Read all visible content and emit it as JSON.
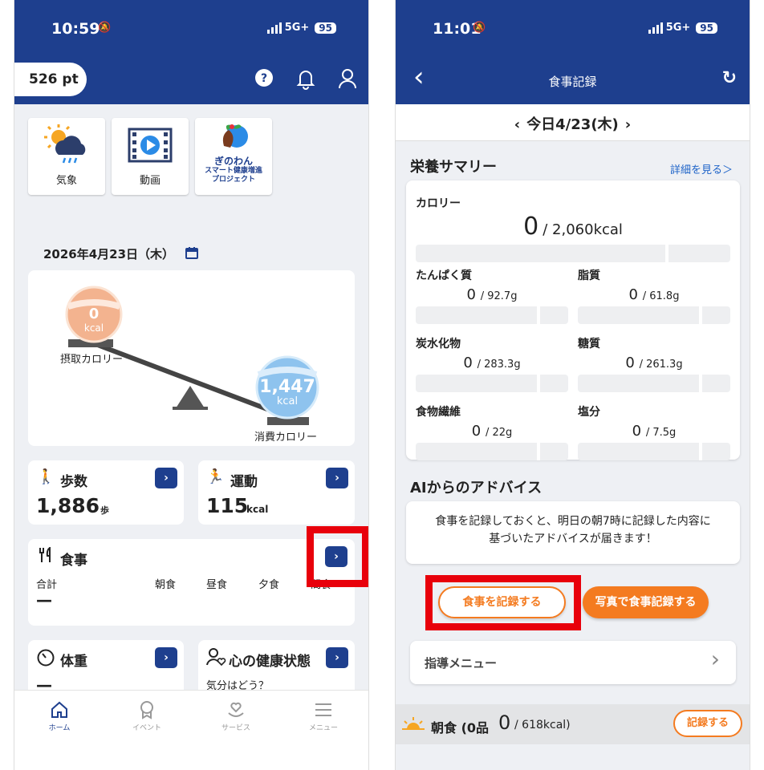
{
  "left": {
    "status": {
      "time": "10:59",
      "network": "5G+",
      "battery": "95"
    },
    "header": {
      "points": "526 pt"
    },
    "tiles": [
      {
        "label": "気象",
        "icon": "weather-icon"
      },
      {
        "label": "動画",
        "icon": "video-icon"
      },
      {
        "label_lines": [
          "ぎのわん",
          "スマート健康増進",
          "プロジェクト"
        ],
        "icon": "ginowan-logo"
      }
    ],
    "date": "2026年4月23日（木）",
    "balance": {
      "intake_value": "0",
      "intake_unit": "kcal",
      "intake_label": "摂取カロリー",
      "burn_value": "1,447",
      "burn_unit": "kcal",
      "burn_label": "消費カロリー"
    },
    "steps": {
      "title": "歩数",
      "value": "1,886",
      "unit": "歩"
    },
    "exercise": {
      "title": "運動",
      "value": "115",
      "unit": "kcal"
    },
    "meal": {
      "title": "食事",
      "total": "合計",
      "breakfast": "朝食",
      "lunch": "昼食",
      "dinner": "夕食",
      "snack": "間食",
      "dash": "—"
    },
    "weight": {
      "title": "体重",
      "dash": "—"
    },
    "mental": {
      "title": "心の健康状態",
      "sub": "気分はどう？"
    },
    "nav": [
      "ホーム",
      "イベント",
      "サービス",
      "メニュー"
    ],
    "arrow": "›"
  },
  "right": {
    "status": {
      "time": "11:01",
      "network": "5G+",
      "battery": "95"
    },
    "header": {
      "title": "食事記録",
      "back": "‹",
      "refresh": "↻"
    },
    "datebar": {
      "prev": "‹",
      "date": "今日4/23(木)",
      "next": "›"
    },
    "summary": {
      "title": "栄養サマリー",
      "detail_link": "詳細を見る＞"
    },
    "calorie": {
      "label": "カロリー",
      "value": "0",
      "target": "/ 2,060kcal",
      "progress": 0
    },
    "nutrients": [
      {
        "label": "たんぱく質",
        "value": "0",
        "target": "/ 92.7g",
        "progress": 0
      },
      {
        "label": "脂質",
        "value": "0",
        "target": "/ 61.8g",
        "progress": 0
      },
      {
        "label": "炭水化物",
        "value": "0",
        "target": "/ 283.3g",
        "progress": 0
      },
      {
        "label": "糖質",
        "value": "0",
        "target": "/ 261.3g",
        "progress": 0
      },
      {
        "label": "食物繊維",
        "value": "0",
        "target": "/ 22g",
        "progress": 0
      },
      {
        "label": "塩分",
        "value": "0",
        "target": "/ 7.5g",
        "progress": 0
      }
    ],
    "advice": {
      "title": "AIからのアドバイス",
      "line1": "食事を記録しておくと、明日の朝7時に記録した内容に",
      "line2": "基づいたアドバイスが届きます！"
    },
    "buttons": {
      "record": "食事を記録する",
      "photo_record": "写真で食事記録する"
    },
    "guidance": {
      "label": "指導メニュー",
      "chevron": "›"
    },
    "breakfast": {
      "label": "朝食 (0品",
      "value": "0",
      "target": "/ 618kcal)",
      "record": "記録する"
    }
  },
  "colors": {
    "brand_blue": "#1e3f8e",
    "accent_orange": "#f47b20",
    "highlight_red": "#e8000b"
  }
}
